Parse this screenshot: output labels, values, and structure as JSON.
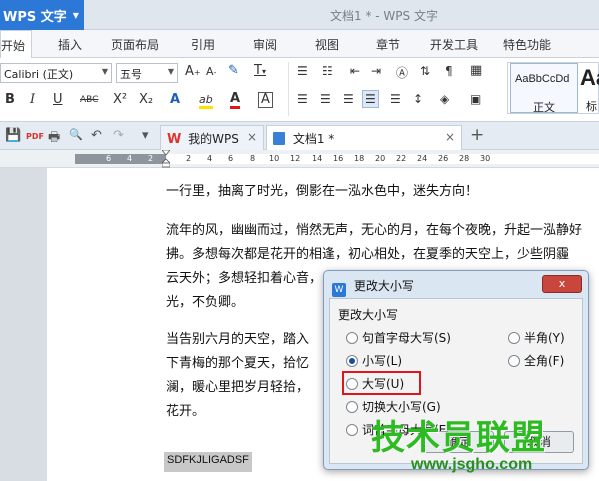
{
  "app": {
    "menu_label": "WPS 文字",
    "window_title": "文档1 * - WPS 文字"
  },
  "ribbon_tabs": [
    "开始",
    "插入",
    "页面布局",
    "引用",
    "审阅",
    "视图",
    "章节",
    "开发工具",
    "特色功能"
  ],
  "ribbon": {
    "font_name": "Calibri (正文)",
    "font_size": "五号",
    "buttons": {
      "grow_font": "A",
      "shrink_font": "A",
      "clear_format": "✎",
      "phonetic": "T",
      "bold": "B",
      "italic": "I",
      "underline": "U",
      "strikethrough": "ABC",
      "superscript": "X²",
      "subscript": "X₂",
      "text_effect": "A",
      "highlight": "ab",
      "font_color": "A",
      "char_border": "A"
    },
    "styles": [
      {
        "sample": "AaBbCcDd",
        "label": "正文"
      },
      {
        "sample": "Aa",
        "label": "标"
      }
    ]
  },
  "quick_access": {
    "save_icon": "💾",
    "pdf_icon": "PDF",
    "print_icon": "🖶",
    "preview_icon": "🔍",
    "undo_icon": "↶",
    "redo_icon": "↷",
    "more_icon": "▾"
  },
  "doc_tabs": [
    {
      "label": "我的WPS",
      "close": "×",
      "active": false
    },
    {
      "label": "文档1 *",
      "close": "×",
      "active": true
    }
  ],
  "new_tab_label": "+",
  "ruler_numbers": [
    "6",
    "4",
    "2",
    "2",
    "4",
    "6",
    "8",
    "10",
    "12",
    "14",
    "16",
    "18",
    "20",
    "22",
    "24",
    "26",
    "28",
    "30"
  ],
  "document": {
    "paragraphs": [
      "一行里，抽离了时光，倒影在一泓水色中，迷失方向！",
      "",
      "流年的风，幽幽而过，悄然无声，无心的月，在每个夜晚，升起一泓静好",
      "拂。多想每次都是花开的相逢，初心相处，在夏季的天空上，少些阴霾",
      "云天外；多想轻扣着心音，",
      "光，不负卿。",
      "",
      "当告别六月的天空，踏入",
      "下青梅的那个夏天，拾忆",
      "澜，暖心里把岁月轻拾，",
      "花开。"
    ],
    "selected_text": "SDFKJLIGADSF"
  },
  "dialog": {
    "title": "更改大小写",
    "close_label": "x",
    "group_label": "更改大小写",
    "options_left": [
      {
        "label": "句首字母大写(S)",
        "checked": false
      },
      {
        "label": "小写(L)",
        "checked": true
      },
      {
        "label": "大写(U)",
        "checked": false
      },
      {
        "label": "切换大小写(G)",
        "checked": false
      },
      {
        "label": "词首字母大写(E)",
        "checked": false
      }
    ],
    "options_right": [
      {
        "label": "半角(Y)",
        "checked": false
      },
      {
        "label": "全角(F)",
        "checked": false
      }
    ],
    "ok_label": "确定",
    "cancel_label": "取消"
  },
  "watermark": {
    "title": "技术员联盟",
    "url": "www.jsgho.com"
  },
  "colors": {
    "accent": "#2b78d6",
    "highlight_box": "#e0141a",
    "watermark_green": "#2dbb22"
  }
}
